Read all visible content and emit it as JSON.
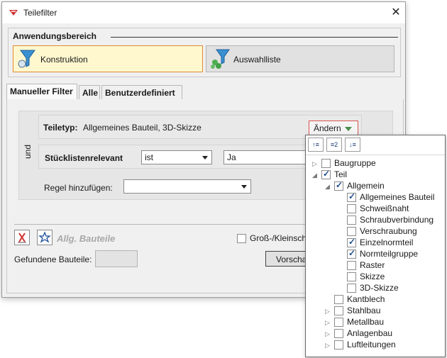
{
  "window": {
    "title": "Teilefilter",
    "close_label": "✕"
  },
  "scope": {
    "title": "Anwendungsbereich",
    "buttons": [
      {
        "label": "Konstruktion",
        "active": true
      },
      {
        "label": "Auswahlliste",
        "active": false
      }
    ]
  },
  "tabs": [
    {
      "label": "Manueller Filter",
      "active": true
    },
    {
      "label": "Alle",
      "active": false
    },
    {
      "label": "Benutzerdefiniert",
      "active": false
    }
  ],
  "filter": {
    "teiletyp_label": "Teiletyp:",
    "teiletyp_value": "Allgemeines Bauteil, 3D-Skizze",
    "change_button": "Ändern",
    "und_label": "und",
    "stuckliste_label": "Stücklistenrelevant",
    "operator_value": "ist",
    "value_value": "Ja",
    "add_rule_label": "Regel hinzufügen:",
    "add_rule_value": ""
  },
  "bottom": {
    "rule_name": "Allg. Bauteile",
    "case_label": "Groß-/Kleinschr",
    "found_label": "Gefundene Bauteile:",
    "found_value": "",
    "preview_button": "Vorschau"
  },
  "popup": {
    "toolbar_icons": [
      "expand-all-icon",
      "level-2-icon",
      "collapse-all-icon"
    ],
    "tree": [
      {
        "label": "Baugruppe",
        "level": 0,
        "checked": false,
        "expander": "closed"
      },
      {
        "label": "Teil",
        "level": 0,
        "checked": true,
        "expander": "open"
      },
      {
        "label": "Allgemein",
        "level": 1,
        "checked": true,
        "expander": "open"
      },
      {
        "label": "Allgemeines Bauteil",
        "level": 2,
        "checked": true,
        "expander": "none"
      },
      {
        "label": "Schweißnaht",
        "level": 2,
        "checked": false,
        "expander": "none"
      },
      {
        "label": "Schraubverbindung",
        "level": 2,
        "checked": false,
        "expander": "none"
      },
      {
        "label": "Verschraubung",
        "level": 2,
        "checked": false,
        "expander": "none"
      },
      {
        "label": "Einzelnormteil",
        "level": 2,
        "checked": true,
        "expander": "none"
      },
      {
        "label": "Normteilgruppe",
        "level": 2,
        "checked": true,
        "expander": "none"
      },
      {
        "label": "Raster",
        "level": 2,
        "checked": false,
        "expander": "none"
      },
      {
        "label": "Skizze",
        "level": 2,
        "checked": false,
        "expander": "none"
      },
      {
        "label": "3D-Skizze",
        "level": 2,
        "checked": false,
        "expander": "none"
      },
      {
        "label": "Kantblech",
        "level": 1,
        "checked": false,
        "expander": "none"
      },
      {
        "label": "Stahlbau",
        "level": 1,
        "checked": false,
        "expander": "closed"
      },
      {
        "label": "Metallbau",
        "level": 1,
        "checked": false,
        "expander": "closed"
      },
      {
        "label": "Anlagenbau",
        "level": 1,
        "checked": false,
        "expander": "closed"
      },
      {
        "label": "Luftleitungen",
        "level": 1,
        "checked": false,
        "expander": "closed"
      }
    ]
  },
  "colors": {
    "active_border": "#e08a33",
    "active_fill": "#fff8cf",
    "change_border": "#d9534f"
  }
}
